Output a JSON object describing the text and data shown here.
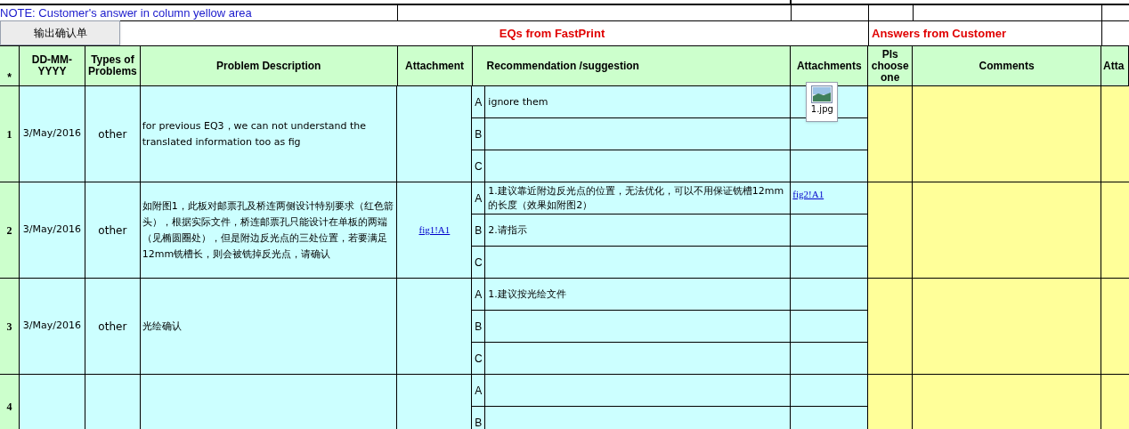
{
  "note": "NOTE: Customer's  answer in column yellow area",
  "export_button": "输出确认单",
  "section_titles": [
    "EQs from FastPrint",
    "Answers from Customer"
  ],
  "columns": [
    "*",
    "DD-MM-YYYY",
    "Types of Problems",
    "Problem Description",
    "Attachment",
    "Recommendation /suggestion",
    "Attachments",
    "Pls choose one",
    "Comments",
    "Atta"
  ],
  "rows": [
    {
      "number": "1",
      "date": "3/May/2016",
      "type": "other",
      "description": "for previous EQ3，we can not understand the translated information too as fig",
      "options": [
        {
          "letter": "A",
          "text": "ignore them",
          "attachment": {
            "kind": "file",
            "name": "1.jpg"
          }
        },
        {
          "letter": "B"
        },
        {
          "letter": "C"
        }
      ]
    },
    {
      "number": "2",
      "date": "3/May/2016",
      "type": "other",
      "description": "如附图1，此板对邮票孔及桥连两侧设计特别要求（红色箭头），根据实际文件，桥连邮票孔只能设计在单板的两端（见椭圆圈处），但是附边反光点的三处位置，若要满足12mm铣槽长，则会被铣掉反光点，请确认",
      "attachment": "fig1!A1",
      "options": [
        {
          "letter": "A",
          "text": "1.建议靠近附边反光点的位置，无法优化，可以不用保证铣槽12mm的长度（效果如附图2）",
          "attachment": {
            "kind": "link",
            "text": "fig2!A1"
          }
        },
        {
          "letter": "B",
          "text": "2.请指示"
        },
        {
          "letter": "C"
        }
      ]
    },
    {
      "number": "3",
      "date": "3/May/2016",
      "type": "other",
      "description": "光绘确认",
      "options": [
        {
          "letter": "A",
          "text": "1.建议按光绘文件"
        },
        {
          "letter": "B"
        },
        {
          "letter": "C"
        }
      ]
    },
    {
      "number": "4",
      "options": [
        {
          "letter": "A"
        },
        {
          "letter": "B"
        }
      ]
    }
  ]
}
